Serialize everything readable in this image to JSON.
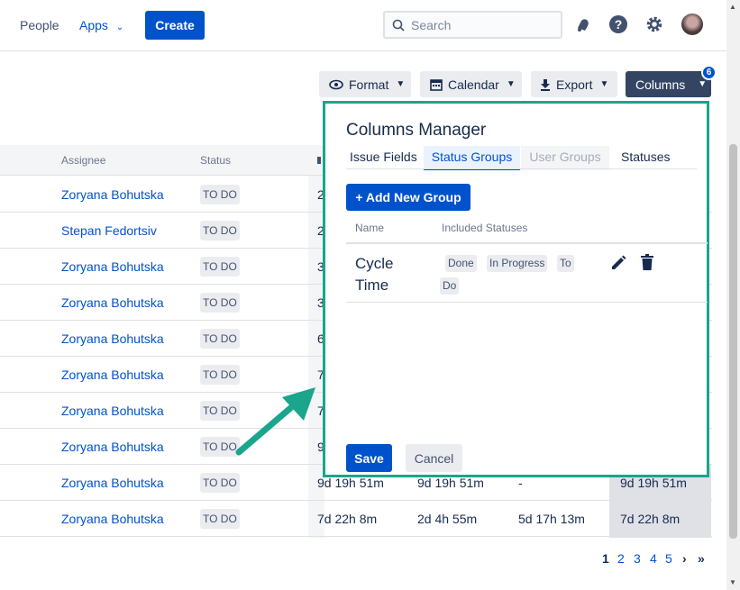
{
  "nav": {
    "people": "People",
    "apps": "Apps",
    "create": "Create",
    "search_placeholder": "Search"
  },
  "toolbar": {
    "format": "Format",
    "calendar": "Calendar",
    "export": "Export",
    "columns": "Columns",
    "columns_badge": "6"
  },
  "table": {
    "headers": {
      "assignee": "Assignee",
      "status": "Status"
    },
    "rows": [
      {
        "assignee": "Zoryana Bohutska",
        "status": "TO DO",
        "c1": "2",
        "c2": "",
        "c3": "",
        "c4": ""
      },
      {
        "assignee": "Stepan Fedortsiv",
        "status": "TO DO",
        "c1": "2",
        "c2": "",
        "c3": "",
        "c4": ""
      },
      {
        "assignee": "Zoryana Bohutska",
        "status": "TO DO",
        "c1": "3",
        "c2": "",
        "c3": "",
        "c4": ""
      },
      {
        "assignee": "Zoryana Bohutska",
        "status": "TO DO",
        "c1": "3",
        "c2": "",
        "c3": "",
        "c4": ""
      },
      {
        "assignee": "Zoryana Bohutska",
        "status": "TO DO",
        "c1": "6",
        "c2": "",
        "c3": "",
        "c4": ""
      },
      {
        "assignee": "Zoryana Bohutska",
        "status": "TO DO",
        "c1": "7",
        "c2": "",
        "c3": "",
        "c4": ""
      },
      {
        "assignee": "Zoryana Bohutska",
        "status": "TO DO",
        "c1": "7",
        "c2": "",
        "c3": "",
        "c4": ""
      },
      {
        "assignee": "Zoryana Bohutska",
        "status": "TO DO",
        "c1": "9",
        "c2": "",
        "c3": "",
        "c4": ""
      },
      {
        "assignee": "Zoryana Bohutska",
        "status": "TO DO",
        "c1": "9d 19h 51m",
        "c2": "9d 19h 51m",
        "c3": "-",
        "c4": "9d 19h 51m"
      },
      {
        "assignee": "Zoryana Bohutska",
        "status": "TO DO",
        "c1": "7d 22h 8m",
        "c2": "2d 4h 55m",
        "c3": "5d 17h 13m",
        "c4": "7d 22h 8m"
      }
    ]
  },
  "pagination": {
    "pages": [
      "1",
      "2",
      "3",
      "4",
      "5"
    ],
    "current": "1",
    "next": "›",
    "last": "»"
  },
  "columns_manager": {
    "title": "Columns Manager",
    "tabs": [
      "Issue Fields",
      "Status Groups",
      "User Groups",
      "Statuses"
    ],
    "active_tab": "Status Groups",
    "add_group": "+ Add New Group",
    "col_name": "Name",
    "col_included": "Included Statuses",
    "groups": [
      {
        "name": "Cycle Time",
        "statuses": [
          "Done",
          "In Progress",
          "To",
          "Do"
        ]
      }
    ],
    "save": "Save",
    "cancel": "Cancel"
  },
  "colors": {
    "accent": "#0052cc",
    "highlight_border": "#1aa58c",
    "arrow": "#1aa58c"
  }
}
